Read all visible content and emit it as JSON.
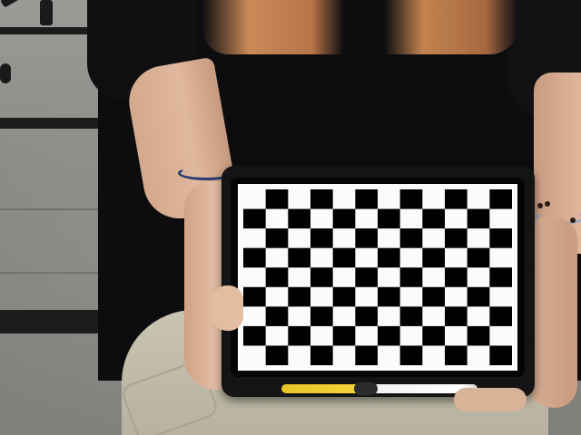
{
  "scene": {
    "subject": "photo",
    "board": {
      "rows": 9,
      "columns": 12,
      "dark_color": "#000000",
      "light_color": "#fbfbf9"
    },
    "colors": {
      "shirt": "#0d0d0f",
      "skin": "#deb59b",
      "pants": "#c9c4b2",
      "floor": "#8f8f8b",
      "rail": "#1b1b1b",
      "tablet_case": "#141416",
      "pencil_band": "#f2d33a"
    }
  }
}
